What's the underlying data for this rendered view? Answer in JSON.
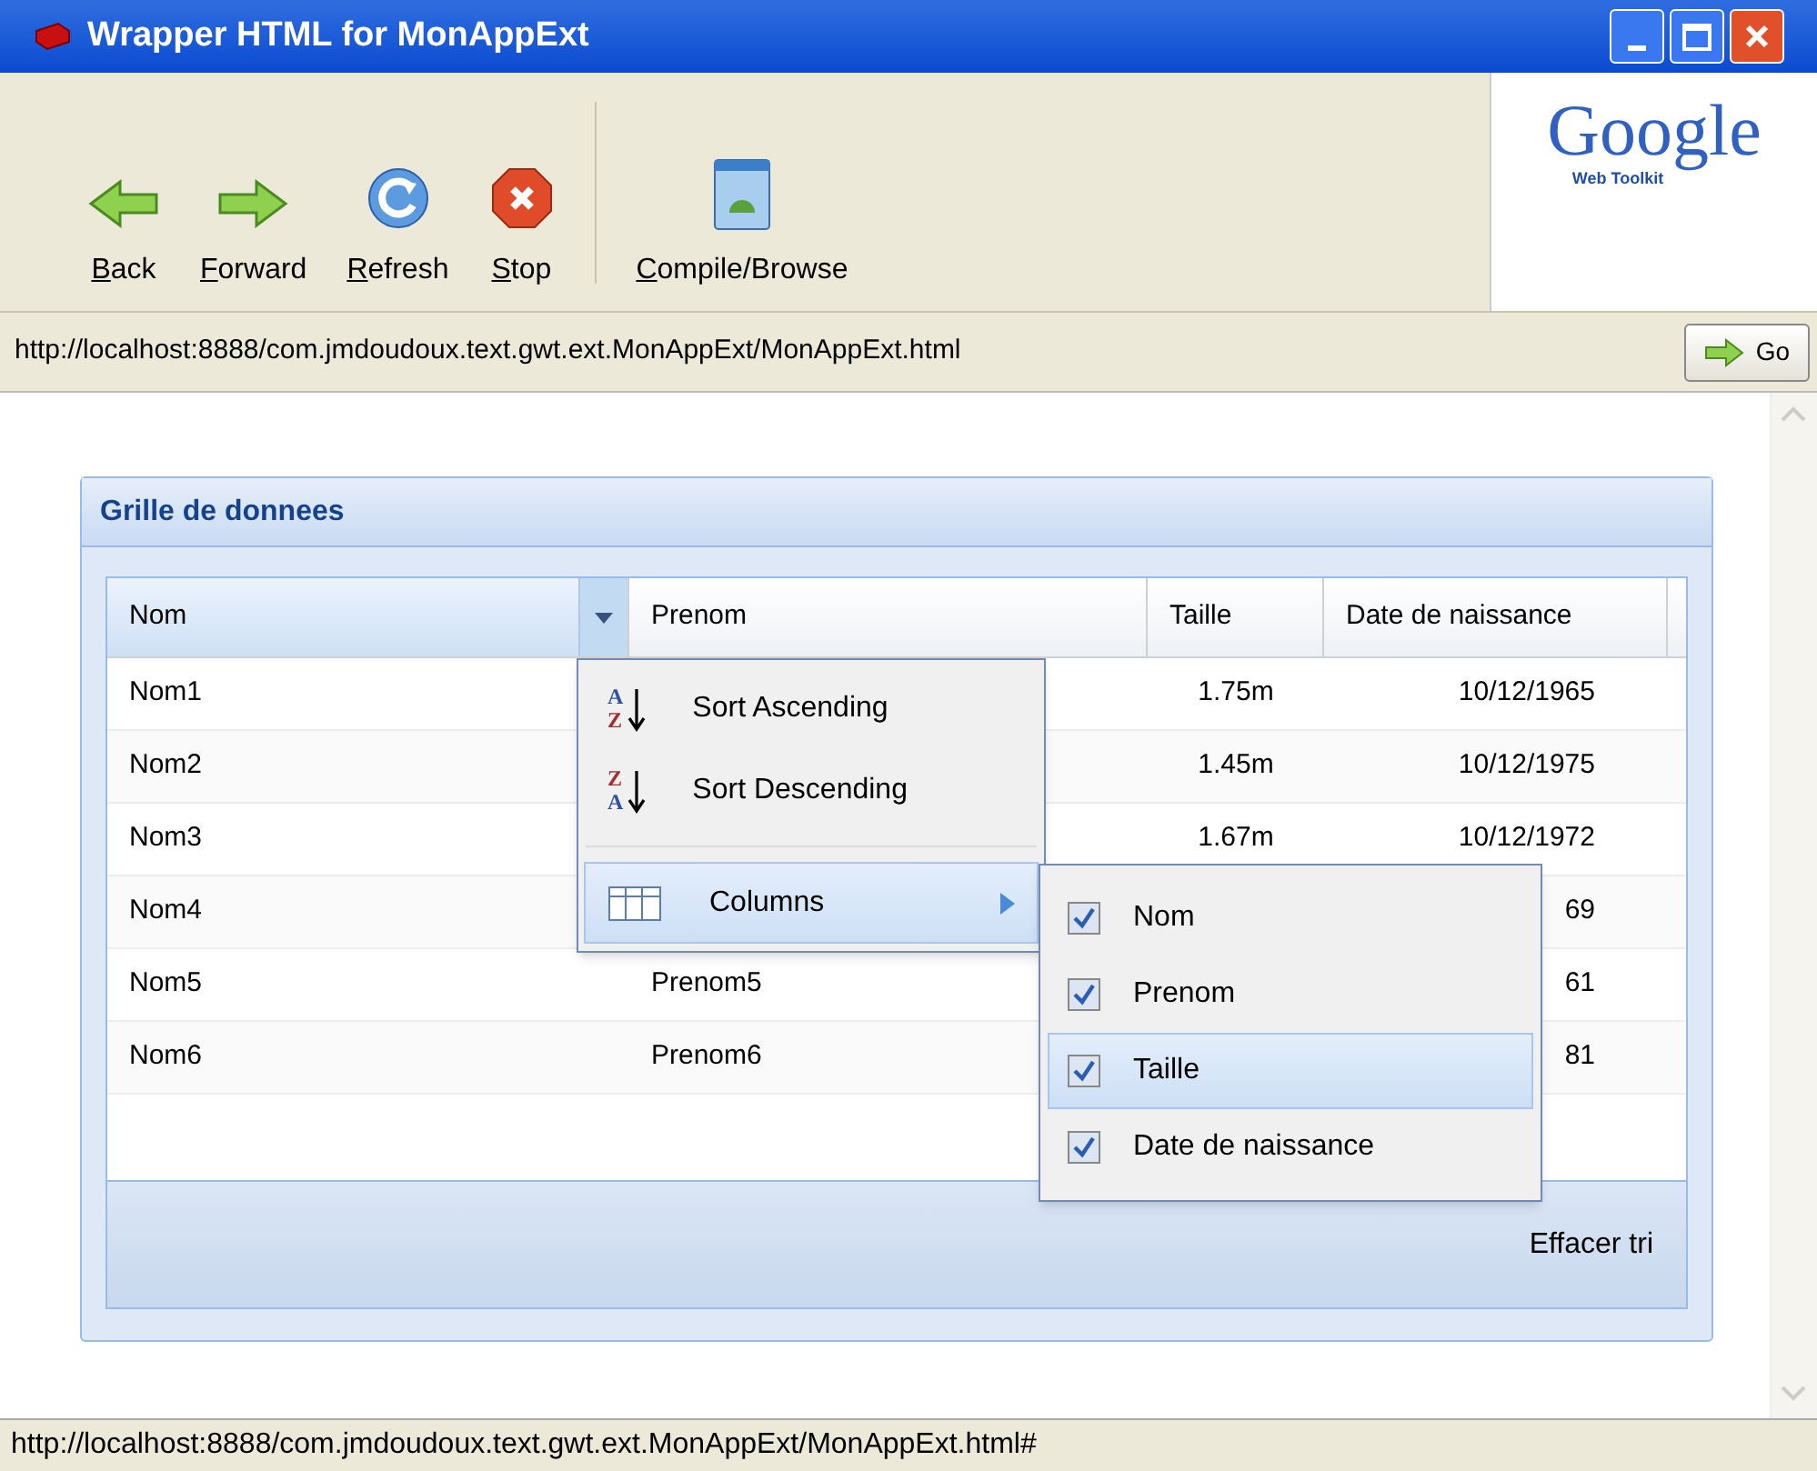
{
  "window": {
    "title": "Wrapper HTML for MonAppExt"
  },
  "toolbar": {
    "buttons": [
      {
        "label": "Back",
        "kind": "back"
      },
      {
        "label": "Forward",
        "kind": "forward"
      },
      {
        "label": "Refresh",
        "kind": "refresh"
      },
      {
        "label": "Stop",
        "kind": "stop"
      },
      {
        "label": "Compile/Browse",
        "kind": "compile"
      }
    ],
    "logo": {
      "text": "Google",
      "subtitle": "Web Toolkit"
    }
  },
  "address": {
    "value": "http://localhost:8888/com.jmdoudoux.text.gwt.ext.MonAppExt/MonAppExt.html",
    "go": "Go"
  },
  "panel": {
    "title": "Grille de donnees",
    "columns": [
      {
        "label": "Nom",
        "active": true
      },
      {
        "label": "Prenom",
        "active": false
      },
      {
        "label": "Taille",
        "active": false
      },
      {
        "label": "Date de naissance",
        "active": false
      }
    ],
    "rows": [
      {
        "nom": "Nom1",
        "taille": "1.75m",
        "date": "10/12/1965"
      },
      {
        "nom": "Nom2",
        "taille": "1.45m",
        "date": "10/12/1975"
      },
      {
        "nom": "Nom3",
        "taille": "1.67m",
        "date": "10/12/1972"
      },
      {
        "nom": "Nom4",
        "date": "69"
      },
      {
        "nom": "Nom5",
        "prenom": "Prenom5",
        "date": "61"
      },
      {
        "nom": "Nom6",
        "prenom": "Prenom6",
        "date": "81"
      }
    ],
    "footer_button": "Effacer tri"
  },
  "menu": {
    "items": [
      {
        "label": "Sort Ascending",
        "kind": "sort-asc",
        "selected": false,
        "icon_letters": [
          "A",
          "Z"
        ]
      },
      {
        "label": "Sort Descending",
        "kind": "sort-desc",
        "selected": false,
        "icon_letters": [
          "Z",
          "A"
        ]
      },
      {
        "kind": "separator"
      },
      {
        "label": "Columns",
        "kind": "submenu",
        "selected": true
      }
    ],
    "submenu": [
      {
        "label": "Nom",
        "checked": true,
        "selected": false
      },
      {
        "label": "Prenom",
        "checked": true,
        "selected": false
      },
      {
        "label": "Taille",
        "checked": true,
        "selected": true
      },
      {
        "label": "Date de naissance",
        "checked": true,
        "selected": false
      }
    ]
  },
  "status_bar": {
    "text": "http://localhost:8888/com.jmdoudoux.text.gwt.ext.MonAppExt/MonAppExt.html#"
  }
}
